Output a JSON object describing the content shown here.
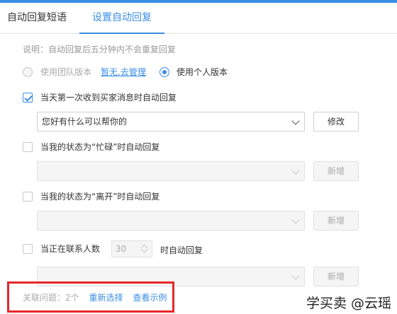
{
  "tabs": [
    {
      "label": "自动回复短语"
    },
    {
      "label": "设置自动回复"
    }
  ],
  "note": "说明：自动回复后五分钟内不会重复回复",
  "version": {
    "team_label": "使用团队版本",
    "manage_link": "暂无,去管理",
    "personal_label": "使用个人版本",
    "selected": "personal"
  },
  "rules": [
    {
      "label": "当天第一次收到买家消息时自动回复",
      "checked": true,
      "select_value": "您好有什么可以帮你的",
      "button_label": "修改"
    },
    {
      "label": "当我的状态为“忙碌”时自动回复",
      "checked": false,
      "select_value": "",
      "button_label": "新增"
    },
    {
      "label": "当我的状态为“离开”时自动回复",
      "checked": false,
      "select_value": "",
      "button_label": "新增"
    },
    {
      "label": "当正在联系人数",
      "checked": false,
      "count_value": "30",
      "label_suffix": "时自动回复",
      "select_value": "",
      "button_label": "新增"
    }
  ],
  "footer": {
    "related_label": "关联问题：2个",
    "reselect_link": "重新选择",
    "example_link": "查看示例"
  },
  "watermark": "学买卖 @云瑶",
  "colors": {
    "accent": "#3a8ee6",
    "highlight": "#e8262a"
  }
}
